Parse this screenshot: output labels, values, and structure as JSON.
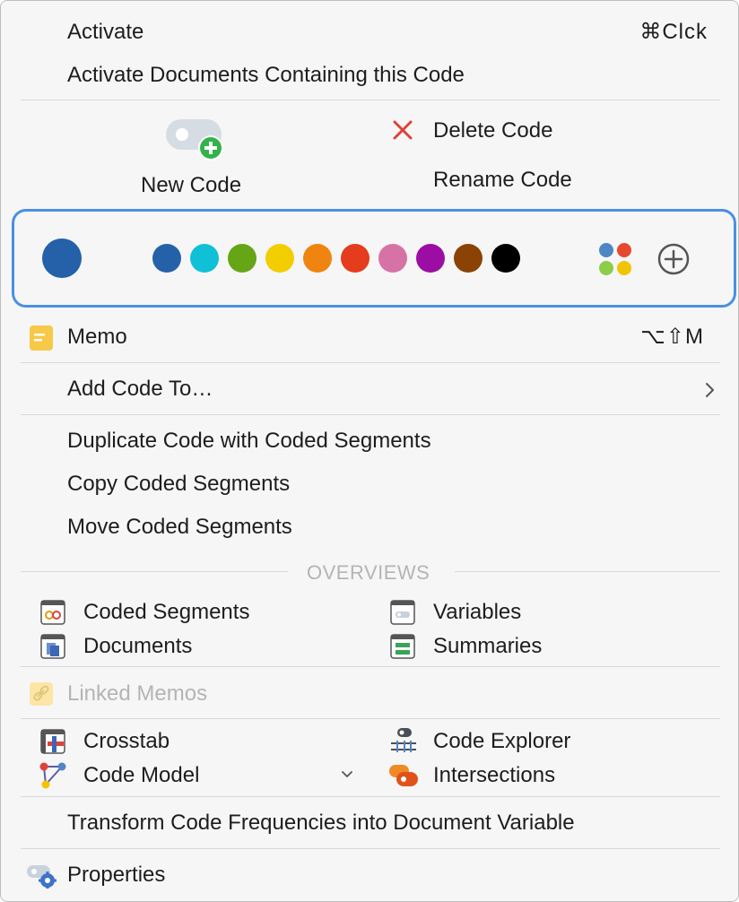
{
  "menu": {
    "activate": {
      "label": "Activate",
      "shortcut": "⌘Clck"
    },
    "activate_docs": {
      "label": "Activate Documents Containing this Code"
    },
    "new_code": {
      "label": "New Code"
    },
    "delete_code": {
      "label": "Delete Code"
    },
    "rename_code": {
      "label": "Rename Code"
    },
    "current_color": "#2561a8",
    "palette": [
      "#2561a8",
      "#0fc0d6",
      "#66a516",
      "#f2cd00",
      "#ef8410",
      "#e43c1c",
      "#d772a6",
      "#9c0ea3",
      "#8a4304",
      "#000000"
    ],
    "memo": {
      "label": "Memo",
      "shortcut": "⌥⇧M"
    },
    "add_code_to": {
      "label": "Add Code To…",
      "submenu_icon": "chevron-right-icon"
    },
    "duplicate": {
      "label": "Duplicate Code with Coded Segments"
    },
    "copy_segments": {
      "label": "Copy Coded Segments"
    },
    "move_segments": {
      "label": "Move Coded Segments"
    },
    "overviews_header": "OVERVIEWS",
    "overviews": {
      "coded_segments": "Coded Segments",
      "variables": "Variables",
      "documents": "Documents",
      "summaries": "Summaries"
    },
    "linked_memos": {
      "label": "Linked Memos"
    },
    "tools": {
      "crosstab": "Crosstab",
      "code_explorer": "Code Explorer",
      "code_model": "Code Model",
      "intersections": "Intersections"
    },
    "transform": {
      "label": "Transform Code Frequencies into Document Variable"
    },
    "properties": {
      "label": "Properties"
    }
  }
}
